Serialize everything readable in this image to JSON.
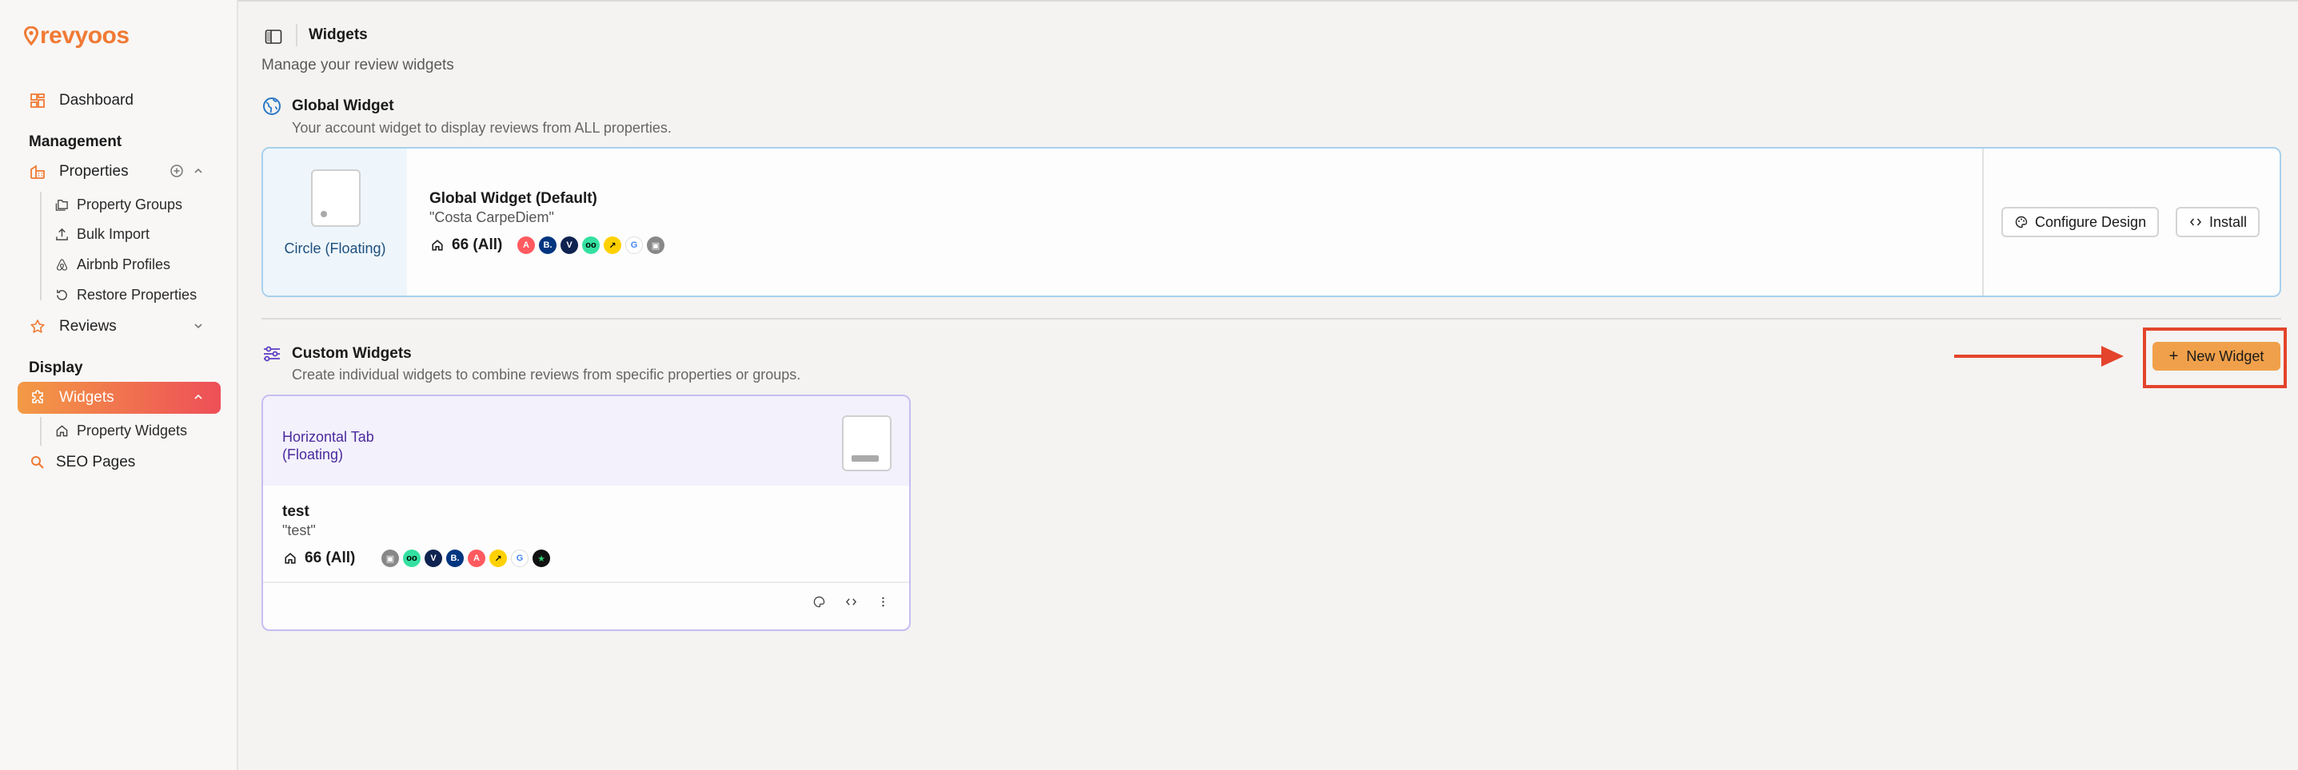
{
  "sidebar": {
    "logo": "revyoos",
    "dashboard": "Dashboard",
    "management_label": "Management",
    "properties": "Properties",
    "property_groups": "Property Groups",
    "bulk_import": "Bulk Import",
    "airbnb_profiles": "Airbnb Profiles",
    "restore_properties": "Restore Properties",
    "reviews": "Reviews",
    "display_label": "Display",
    "widgets": "Widgets",
    "property_widgets": "Property Widgets",
    "seo_pages": "SEO Pages"
  },
  "header": {
    "title": "Widgets",
    "subtitle": "Manage your review widgets"
  },
  "global": {
    "section_title": "Global Widget",
    "section_desc": "Your account widget to display reviews from ALL properties.",
    "type": "Circle (Floating)",
    "name": "Global Widget (Default)",
    "quote": "\"Costa CarpeDiem\"",
    "count": "66 (All)",
    "configure_label": "Configure Design",
    "install_label": "Install"
  },
  "custom": {
    "section_title": "Custom Widgets",
    "section_desc": "Create individual widgets to combine reviews from specific properties or groups.",
    "new_widget_label": "New Widget",
    "widget": {
      "type": "Horizontal Tab (Floating)",
      "name": "test",
      "quote": "\"test\"",
      "count": "66 (All)"
    }
  },
  "colors": {
    "accent": "#f07a34",
    "active_start": "#f39a45",
    "active_end": "#ee4f58",
    "annotation": "#e3442b"
  }
}
